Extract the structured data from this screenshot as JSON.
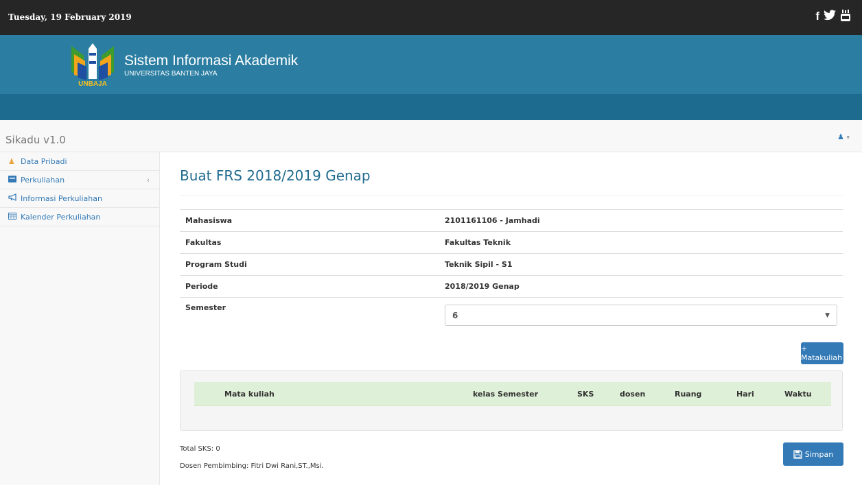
{
  "topbar": {
    "date": "Tuesday, 19 February 2019",
    "social_icons": [
      "facebook-icon",
      "twitter-icon",
      "youtube-icon"
    ]
  },
  "header": {
    "title": "Sistem Informasi Akademik",
    "subtitle": "UNIVERSITAS BANTEN JAYA",
    "logo_text": "UNBAJA"
  },
  "navbar": {
    "brand": "Sikadu v1.0"
  },
  "sidebar": {
    "items": [
      {
        "label": "Data Pribadi",
        "icon": "user-icon"
      },
      {
        "label": "Perkuliahan",
        "icon": "inbox-icon"
      },
      {
        "label": "Informasi Perkuliahan",
        "icon": "bullhorn-icon"
      },
      {
        "label": "Kalender Perkuliahan",
        "icon": "calendar-icon"
      }
    ]
  },
  "main": {
    "title": "Buat FRS 2018/2019 Genap",
    "info": [
      {
        "label": "Mahasiswa",
        "value": "2101161106 - Jamhadi"
      },
      {
        "label": "Fakultas",
        "value": "Fakultas Teknik"
      },
      {
        "label": "Program Studi",
        "value": "Teknik Sipil - S1"
      },
      {
        "label": "Periode",
        "value": "2018/2019 Genap"
      }
    ],
    "semester_label": "Semester",
    "semester_value": "6",
    "add_button": "+ Matakuliah",
    "table_headers": [
      "Mata kuliah",
      "kelas Semester",
      "SKS",
      "dosen",
      "Ruang",
      "Hari",
      "Waktu"
    ],
    "total_sks": "Total SKS: 0",
    "advisor": "Dosen Pembimbing: Fitri Dwi Rani,ST.,Msi.",
    "save_button": "Simpan"
  },
  "colors": {
    "topbar": "#262626",
    "banner": "#2b7ea2",
    "stripe": "#1d6b8e",
    "primary": "#337ab7",
    "table_header": "#dff0d8"
  }
}
